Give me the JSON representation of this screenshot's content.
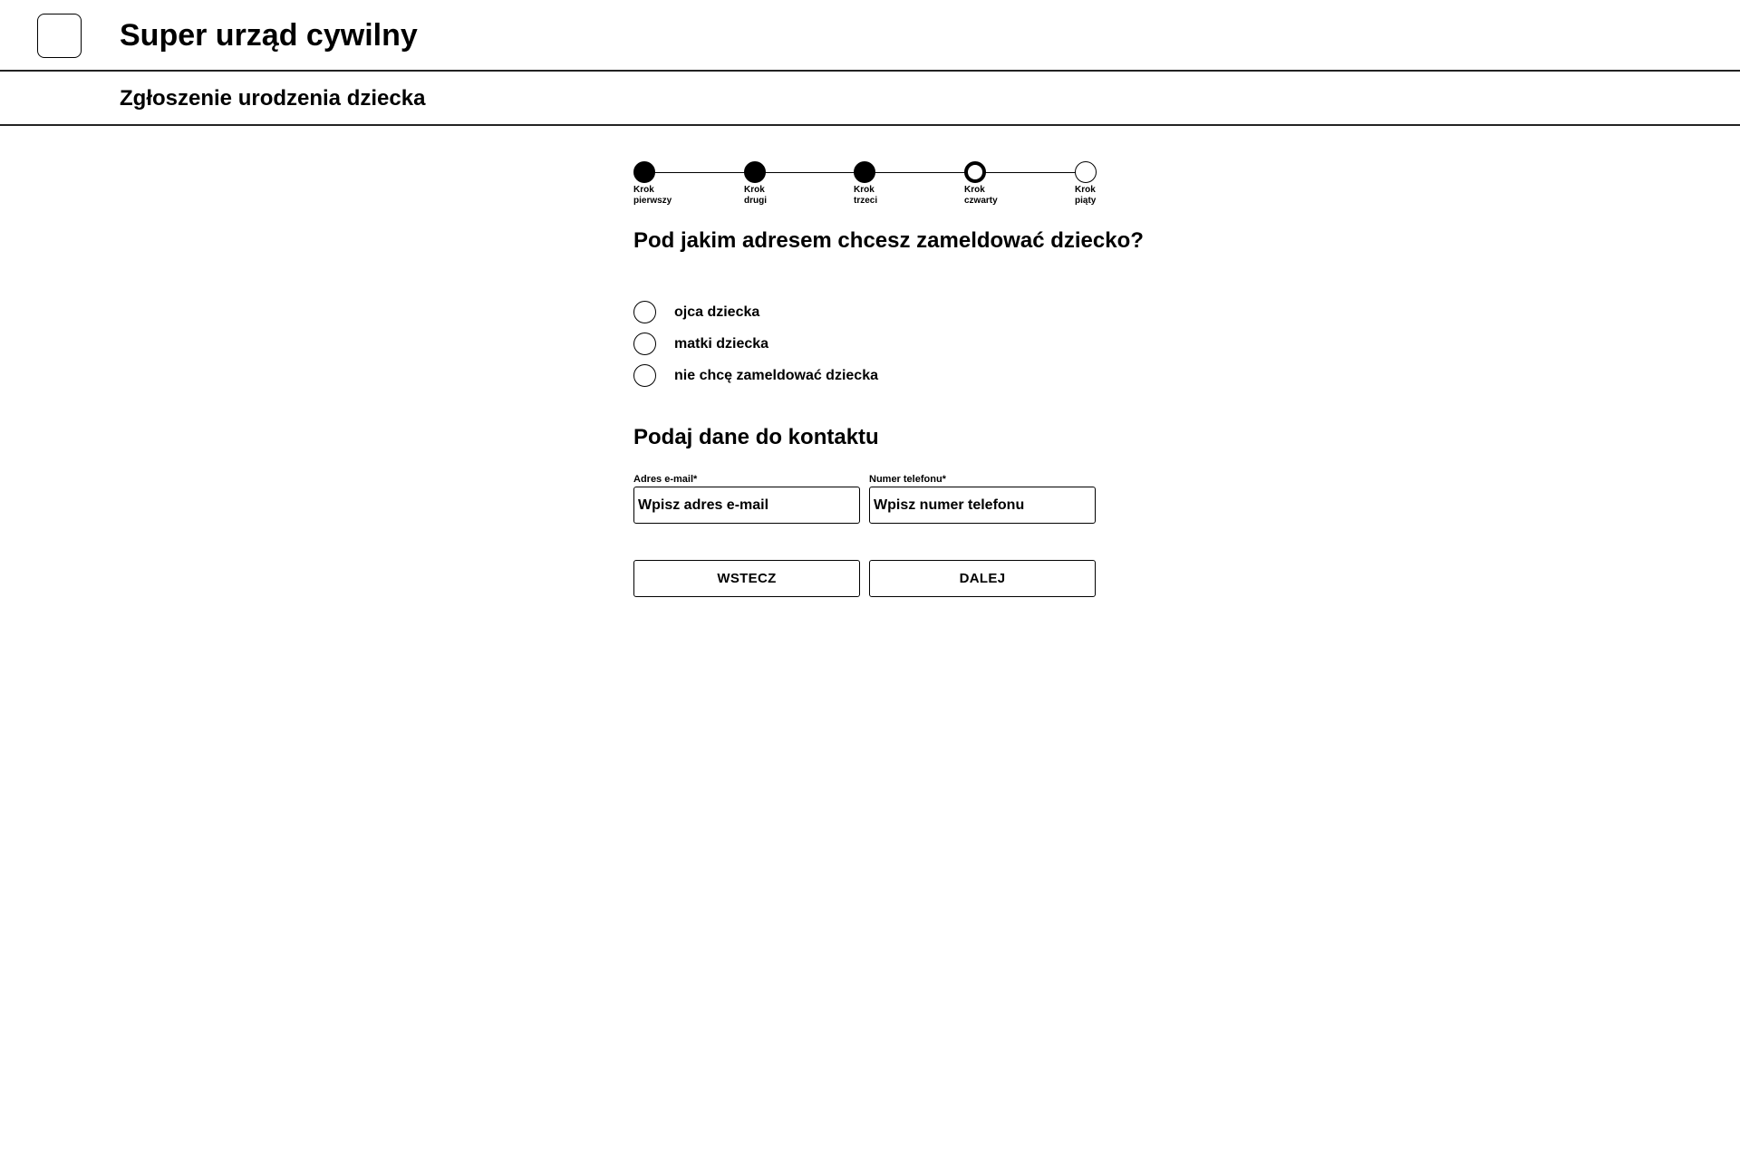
{
  "header": {
    "logo_icon": "app-logo-placeholder",
    "title": "Super urząd cywilny"
  },
  "subheader": {
    "title": "Zgłoszenie urodzenia dziecka"
  },
  "stepper": {
    "steps": [
      {
        "line1": "Krok",
        "line2": "pierwszy",
        "state": "done"
      },
      {
        "line1": "Krok",
        "line2": "drugi",
        "state": "done"
      },
      {
        "line1": "Krok",
        "line2": "trzeci",
        "state": "done"
      },
      {
        "line1": "Krok",
        "line2": "czwarty",
        "state": "current"
      },
      {
        "line1": "Krok",
        "line2": "piąty",
        "state": "todo"
      }
    ]
  },
  "address_question": {
    "title": "Pod jakim adresem chcesz zameldować dziecko?",
    "options": [
      {
        "label": "ojca dziecka",
        "selected": false
      },
      {
        "label": "matki dziecka",
        "selected": false
      },
      {
        "label": "nie chcę zameldować dziecka",
        "selected": false
      }
    ]
  },
  "contact": {
    "title": "Podaj dane do kontaktu",
    "email": {
      "label": "Adres e-mail*",
      "placeholder": "Wpisz adres e-mail",
      "value": ""
    },
    "phone": {
      "label": "Numer telefonu*",
      "placeholder": "Wpisz numer telefonu",
      "value": ""
    }
  },
  "actions": {
    "back_label": "WSTECZ",
    "next_label": "DALEJ"
  }
}
